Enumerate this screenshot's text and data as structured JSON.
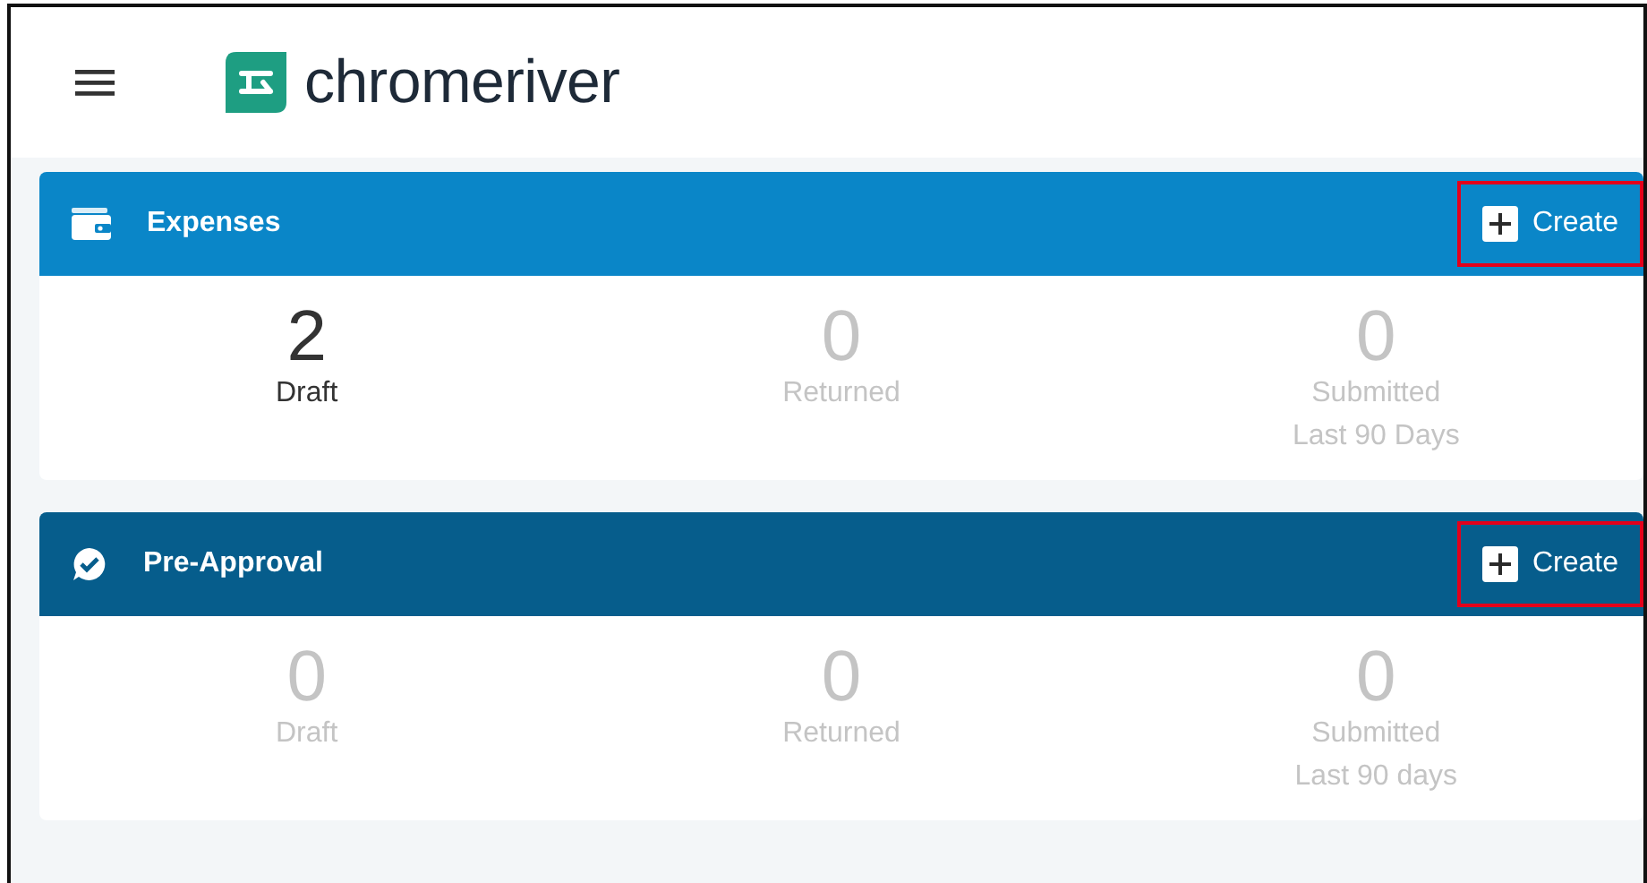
{
  "header": {
    "brand": "chromeriver"
  },
  "sections": [
    {
      "kind": "expenses",
      "title": "Expenses",
      "create": {
        "label": "Create",
        "annotated": true
      },
      "stats": [
        {
          "value": "2",
          "label": "Draft",
          "highlighted": true
        },
        {
          "value": "0",
          "label": "Returned",
          "highlighted": false
        },
        {
          "value": "0",
          "label": "Submitted",
          "sublabel": "Last 90 Days",
          "highlighted": false
        }
      ]
    },
    {
      "kind": "pre-approval",
      "title": "Pre-Approval",
      "create": {
        "label": "Create",
        "annotated": true
      },
      "stats": [
        {
          "value": "0",
          "label": "Draft",
          "highlighted": false
        },
        {
          "value": "0",
          "label": "Returned",
          "highlighted": false
        },
        {
          "value": "0",
          "label": "Submitted",
          "sublabel": "Last 90 days",
          "highlighted": false
        }
      ]
    }
  ]
}
